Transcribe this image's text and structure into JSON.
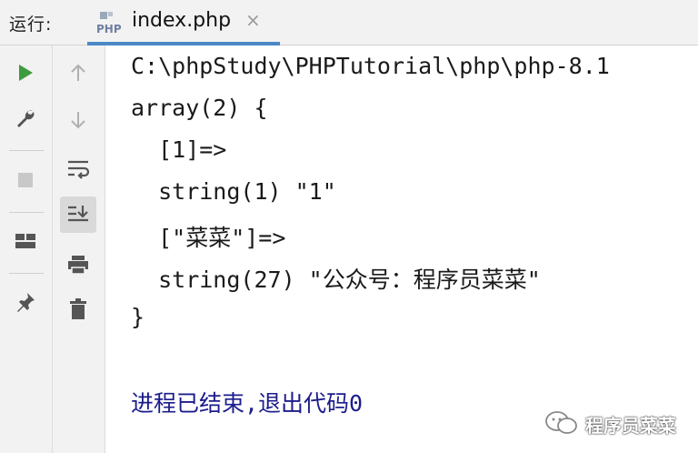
{
  "header": {
    "run_label": "运行:",
    "tab": {
      "title": "index.php",
      "icon": "php-file-icon",
      "close": "×"
    }
  },
  "left_toolbar": {
    "items": [
      "run-icon",
      "wrench-icon",
      "stop-icon",
      "layout-icon",
      "pin-icon"
    ]
  },
  "second_toolbar": {
    "items": [
      "arrow-up-icon",
      "arrow-down-icon",
      "soft-wrap-icon",
      "scroll-to-end-icon",
      "print-icon",
      "trash-icon"
    ],
    "active": "scroll-to-end-icon"
  },
  "console": {
    "lines": [
      "C:\\phpStudy\\PHPTutorial\\php\\php-8.1",
      "array(2) {",
      "  [1]=>",
      "  string(1) \"1\"",
      "  [\"菜菜\"]=>",
      "  string(27) \"公众号：程序员菜菜\"",
      "}",
      "",
      "进程已结束,退出代码0"
    ]
  },
  "watermark": {
    "text": "程序员菜菜"
  },
  "colors": {
    "accent": "#4a88c7",
    "run_green": "#3d9b3d",
    "exit_text": "#1c1c8c",
    "toolbar_bg": "#f2f2f2"
  }
}
